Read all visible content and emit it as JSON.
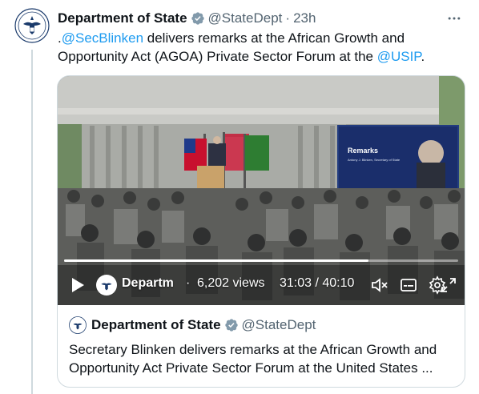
{
  "tweet": {
    "author_name": "Department of State",
    "handle": "@StateDept",
    "separator": "·",
    "timestamp": "23h",
    "text_prefix": ".",
    "mention_1": "@SecBlinken",
    "text_middle": " delivers remarks at the African Growth and Opportunity Act (AGOA) Private Sector Forum at the ",
    "mention_2": "@USIP",
    "text_suffix": "."
  },
  "video": {
    "slide_title": "Remarks",
    "slide_name": "Antony J. Blinken, Secretary of State",
    "channel_name": "Departm",
    "separator": "·",
    "views": "6,202 views",
    "time_readout": "31:03 / 40:10",
    "progress_fraction": 0.773
  },
  "card": {
    "author_name": "Department of State",
    "handle": "@StateDept",
    "description": "Secretary Blinken delivers remarks at the African Growth and Opportunity Act Private Sector Forum at the United States ..."
  },
  "colors": {
    "accent": "#1d9bf0",
    "verified": "#829aab",
    "secondary_text": "#536471"
  },
  "icons": [
    "state-seal-icon",
    "verified-badge-icon",
    "more-icon",
    "play-icon",
    "mute-icon",
    "captions-icon",
    "settings-icon",
    "fullscreen-icon"
  ]
}
